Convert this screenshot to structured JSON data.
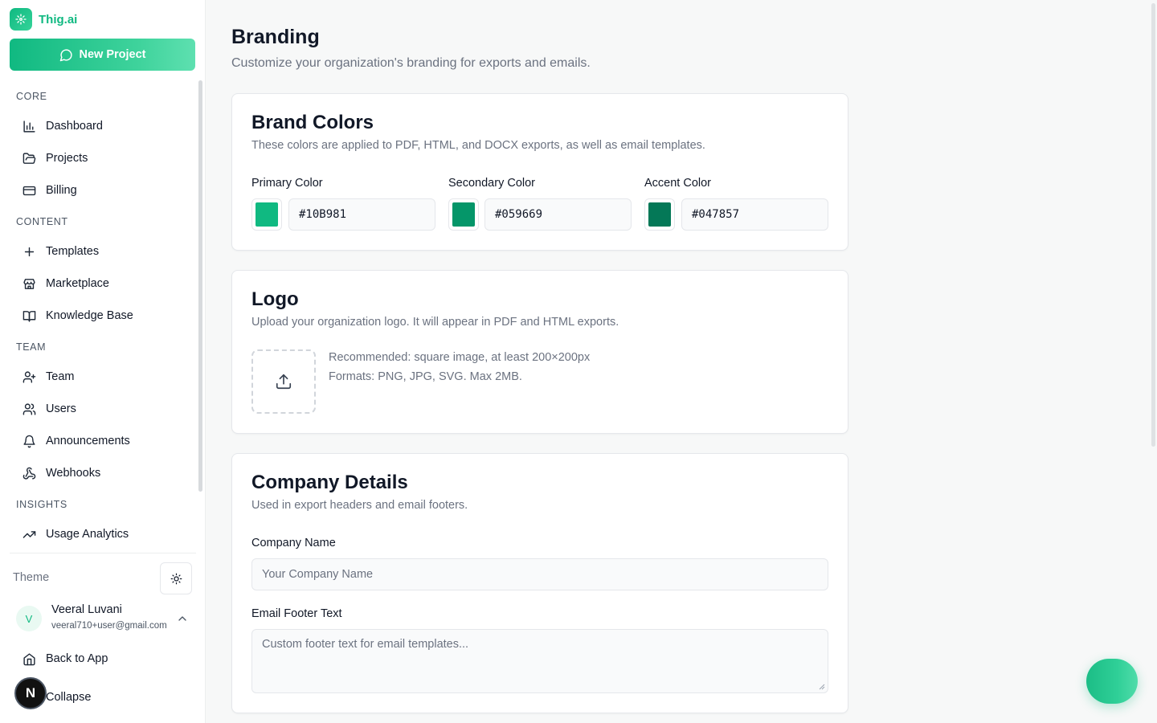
{
  "app": {
    "name": "Thig.ai"
  },
  "sidebar": {
    "new_project_label": "New Project",
    "sections": {
      "core": "CORE",
      "content": "CONTENT",
      "team": "TEAM",
      "insights": "INSIGHTS"
    },
    "items": {
      "dashboard": "Dashboard",
      "projects": "Projects",
      "billing": "Billing",
      "templates": "Templates",
      "marketplace": "Marketplace",
      "knowledge_base": "Knowledge Base",
      "team": "Team",
      "users": "Users",
      "announcements": "Announcements",
      "webhooks": "Webhooks",
      "usage_analytics": "Usage Analytics"
    },
    "theme_label": "Theme",
    "user": {
      "initial": "V",
      "name": "Veeral Luvani",
      "email": "veeral710+user@gmail.com"
    },
    "back_to_app": "Back to App",
    "collapse": "Collapse",
    "dev_badge": "N"
  },
  "page": {
    "title": "Branding",
    "subtitle": "Customize your organization's branding for exports and emails."
  },
  "brand_colors": {
    "title": "Brand Colors",
    "description": "These colors are applied to PDF, HTML, and DOCX exports, as well as email templates.",
    "primary_label": "Primary Color",
    "primary_value": "#10B981",
    "secondary_label": "Secondary Color",
    "secondary_value": "#059669",
    "accent_label": "Accent Color",
    "accent_value": "#047857"
  },
  "logo": {
    "title": "Logo",
    "description": "Upload your organization logo. It will appear in PDF and HTML exports.",
    "hint_size": "Recommended: square image, at least 200×200px",
    "hint_formats": "Formats: PNG, JPG, SVG. Max 2MB."
  },
  "company": {
    "title": "Company Details",
    "description": "Used in export headers and email footers.",
    "name_label": "Company Name",
    "name_placeholder": "Your Company Name",
    "footer_label": "Email Footer Text",
    "footer_placeholder": "Custom footer text for email templates..."
  },
  "colors": {
    "brand": "#10B981",
    "primary": "#10B981",
    "secondary": "#059669",
    "accent": "#047857"
  }
}
